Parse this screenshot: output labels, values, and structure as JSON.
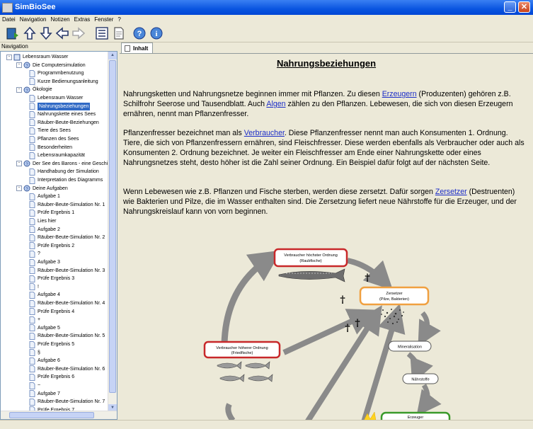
{
  "window": {
    "title": "SimBioSee"
  },
  "menu": [
    "Datei",
    "Navigation",
    "Notizen",
    "Extras",
    "Fenster",
    "?"
  ],
  "toolbar": {
    "icons": [
      "book-icon",
      "arrow-up-icon",
      "arrow-down-icon",
      "arrow-left-icon",
      "arrow-right-icon",
      "list-icon",
      "page-icon",
      "help-icon",
      "info-icon"
    ]
  },
  "nav": {
    "header": "Navigation",
    "items": [
      {
        "label": "Lebensraum Wasser",
        "level": 0,
        "type": "book",
        "expander": "-"
      },
      {
        "label": "Die Computersimulation",
        "level": 1,
        "type": "folder",
        "expander": "-"
      },
      {
        "label": "Programmbenutzung",
        "level": 2,
        "type": "page"
      },
      {
        "label": "Kurze Bedienungsanleitung",
        "level": 2,
        "type": "page"
      },
      {
        "label": "Ökologie",
        "level": 1,
        "type": "folder",
        "expander": "-"
      },
      {
        "label": "Lebensraum Wasser",
        "level": 2,
        "type": "page"
      },
      {
        "label": "Nahrungsbeziehungen",
        "level": 2,
        "type": "page",
        "selected": true
      },
      {
        "label": "Nahrungskette eines Sees",
        "level": 2,
        "type": "page"
      },
      {
        "label": "Räuber-Beute-Beziehungen",
        "level": 2,
        "type": "page"
      },
      {
        "label": "Tiere des Sees",
        "level": 2,
        "type": "page"
      },
      {
        "label": "Pflanzen des Sees",
        "level": 2,
        "type": "page"
      },
      {
        "label": "Besonderheiten",
        "level": 2,
        "type": "page"
      },
      {
        "label": "Lebensraumkapazität",
        "level": 2,
        "type": "page"
      },
      {
        "label": "Der See des Barons - eine Geschich",
        "level": 1,
        "type": "folder",
        "expander": "-"
      },
      {
        "label": "Handhabung der Simulation",
        "level": 2,
        "type": "page"
      },
      {
        "label": "Interpretation des Diagramms",
        "level": 2,
        "type": "page"
      },
      {
        "label": "Deine Aufgaben",
        "level": 1,
        "type": "folder",
        "expander": "-"
      },
      {
        "label": "Aufgabe 1",
        "level": 2,
        "type": "page"
      },
      {
        "label": "Räuber-Beute-Simulation Nr. 1",
        "level": 2,
        "type": "page"
      },
      {
        "label": "Prüfe Ergebnis 1",
        "level": 2,
        "type": "page"
      },
      {
        "label": "Lies hier",
        "level": 2,
        "type": "page"
      },
      {
        "label": "Aufgabe 2",
        "level": 2,
        "type": "page"
      },
      {
        "label": "Räuber-Beute-Simulation Nr. 2",
        "level": 2,
        "type": "page"
      },
      {
        "label": "Prüfe Ergebnis 2",
        "level": 2,
        "type": "page"
      },
      {
        "label": "?",
        "level": 2,
        "type": "page"
      },
      {
        "label": "Aufgabe 3",
        "level": 2,
        "type": "page"
      },
      {
        "label": "Räuber-Beute-Simulation Nr. 3",
        "level": 2,
        "type": "page"
      },
      {
        "label": "Prüfe Ergebnis 3",
        "level": 2,
        "type": "page"
      },
      {
        "label": "!",
        "level": 2,
        "type": "page"
      },
      {
        "label": "Aufgabe 4",
        "level": 2,
        "type": "page"
      },
      {
        "label": "Räuber-Beute-Simulation Nr. 4",
        "level": 2,
        "type": "page"
      },
      {
        "label": "Prüfe Ergebnis 4",
        "level": 2,
        "type": "page"
      },
      {
        "label": "+",
        "level": 2,
        "type": "page"
      },
      {
        "label": "Aufgabe 5",
        "level": 2,
        "type": "page"
      },
      {
        "label": "Räuber-Beute-Simulation Nr. 5",
        "level": 2,
        "type": "page"
      },
      {
        "label": "Prüfe Ergebnis 5",
        "level": 2,
        "type": "page"
      },
      {
        "label": "§",
        "level": 2,
        "type": "page"
      },
      {
        "label": "Aufgabe 6",
        "level": 2,
        "type": "page"
      },
      {
        "label": "Räuber-Beute-Simulation Nr. 6",
        "level": 2,
        "type": "page"
      },
      {
        "label": "Prüfe Ergebnis 6",
        "level": 2,
        "type": "page"
      },
      {
        "label": "~",
        "level": 2,
        "type": "page"
      },
      {
        "label": "Aufgabe 7",
        "level": 2,
        "type": "page"
      },
      {
        "label": "Räuber-Beute-Simulation Nr. 7",
        "level": 2,
        "type": "page"
      },
      {
        "label": "Prüfe Ergebnis 7",
        "level": 2,
        "type": "page"
      }
    ]
  },
  "tab": {
    "label": "Inhalt"
  },
  "content": {
    "title": "Nahrungsbeziehungen",
    "p1": {
      "t1": "Nahrungsketten und Nahrungsnetze beginnen immer mit Pflanzen. Zu diesen ",
      "link1": "Erzeugern",
      "t2": " (Produzenten) gehören z.B. Schilfrohr Seerose und Tausendblatt. Auch ",
      "link2": "Algen",
      "t3": " zählen zu den Pflanzen. Lebewesen, die sich von diesen Erzeugern ernähren, nennt man Pflanzenfresser."
    },
    "p2": {
      "t1": "Pflanzenfresser bezeichnet man als ",
      "link1": "Verbraucher",
      "t2": ". Diese Pflanzenfresser nennt man auch Konsumenten 1. Ordnung. Tiere, die sich von Pflanzenfressern ernähren, sind Fleischfresser. Diese werden ebenfalls als Verbraucher oder auch als Konsumenten 2. Ordnung bezeichnet. Je weiter ein Fleischfresser am Ende einer Nahrungskette oder eines Nahrungsnetzes steht, desto höher ist die Zahl seiner Ordnung. Ein Beispiel dafür folgt auf der nächsten Seite."
    },
    "p3": {
      "t1": "Wenn Lebewesen wie z.B. Pflanzen und Fische sterben, werden diese zersetzt. Dafür sorgen ",
      "link1": "Zersetzer",
      "t2": " (Destruenten) wie Bakterien und Pilze, die im Wasser enthalten sind. Die Zersetzung liefert neue Nährstoffe für die Erzeuger, und der Nahrungskreislauf kann von vorn beginnen."
    },
    "diagram": {
      "top": {
        "line1": "Verbraucher höchster Ordnung",
        "line2": "(Raubfische)"
      },
      "mid": {
        "line1": "Verbraucher höherer Ordnung",
        "line2": "(Friedfische)"
      },
      "zersetzer": {
        "line1": "Zersetzer",
        "line2": "(Pilze, Bakterien)"
      },
      "mineral": "Mineralisation",
      "naehr": "Nährstoffe",
      "erzeuger": "Erzeuger",
      "death_symbol": "†",
      "colors": {
        "red": "#c8282a",
        "orange": "#f0a040",
        "green": "#3a9a2a",
        "arrow": "#8a8a8a"
      }
    }
  }
}
